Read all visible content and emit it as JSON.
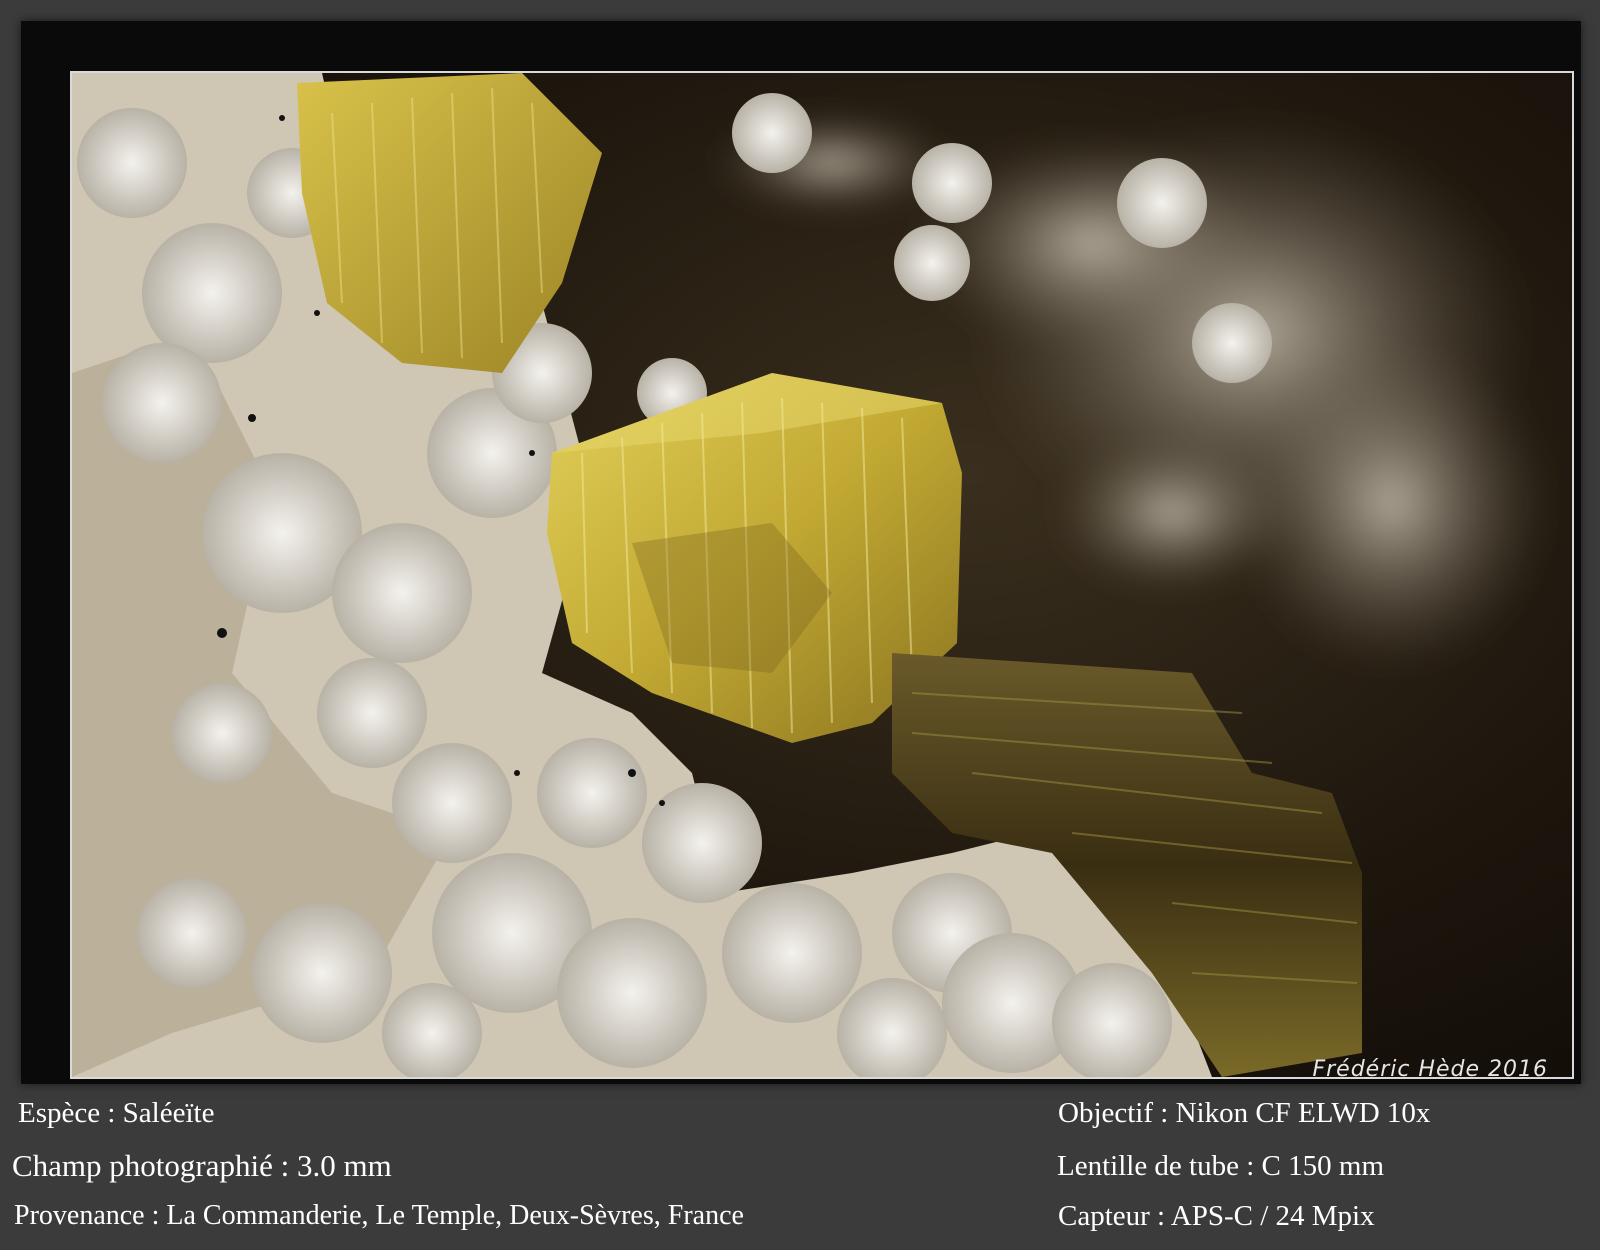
{
  "signature": "Frédéric Hède 2016",
  "left_info": {
    "species": "Espèce : Saléeïte",
    "field": "Champ photographié : 3.0 mm",
    "locality": "Provenance : La Commanderie, Le Temple, Deux-Sèvres, France"
  },
  "right_info": {
    "objective": "Objectif : Nikon CF ELWD 10x",
    "tube_lens": "Lentille de tube : C 150 mm",
    "sensor": "Capteur : APS-C / 24 Mpix"
  },
  "colors": {
    "background": "#3b3b3b",
    "frame": "#0a0a0a",
    "photo_border": "#d9d9d9",
    "crystal_yellow": "#c9b23a",
    "crystal_dark": "#5a4a1c",
    "matrix_white": "#e8e4dc",
    "text": "#ffffff"
  }
}
